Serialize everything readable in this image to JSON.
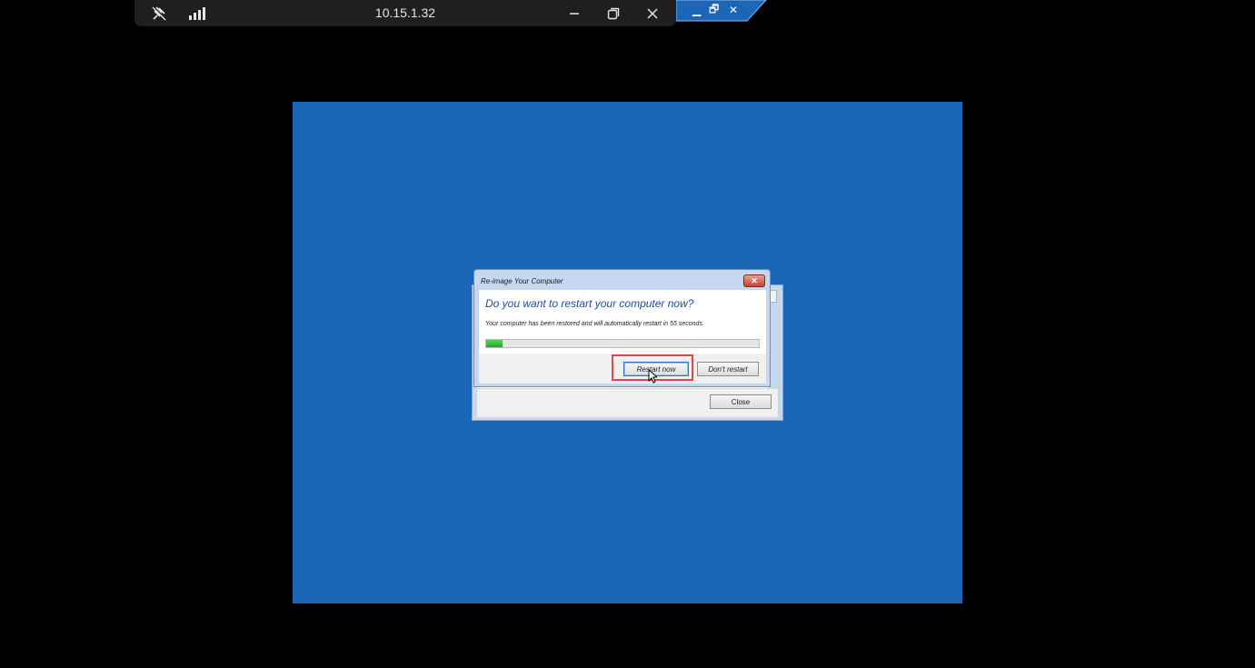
{
  "rdp_bar": {
    "title": "10.15.1.32",
    "pin_icon": "pin-off-icon",
    "signal_icon": "connection-signal-icon",
    "minimize_icon": "minimize-icon",
    "restore_icon": "restore-icon",
    "close_icon": "close-icon"
  },
  "remote_window_controls": {
    "minimize_icon": "minimize-icon",
    "restore_icon": "restore-icon",
    "close_icon": "close-icon",
    "accent": "#1c66b8"
  },
  "desktop": {
    "background": "#1c66b8"
  },
  "dialog": {
    "title": "Re-image Your Computer",
    "close_glyph": "✕",
    "heading": "Do you want to restart your computer now?",
    "message": "Your computer has been restored and will automatically restart in 55 seconds.",
    "progress_fraction": 0.06,
    "restart_label": "Restart now",
    "dont_restart_label": "Don't restart"
  },
  "back_window": {
    "close_label": "Close"
  },
  "highlight_color": "#e2454a"
}
